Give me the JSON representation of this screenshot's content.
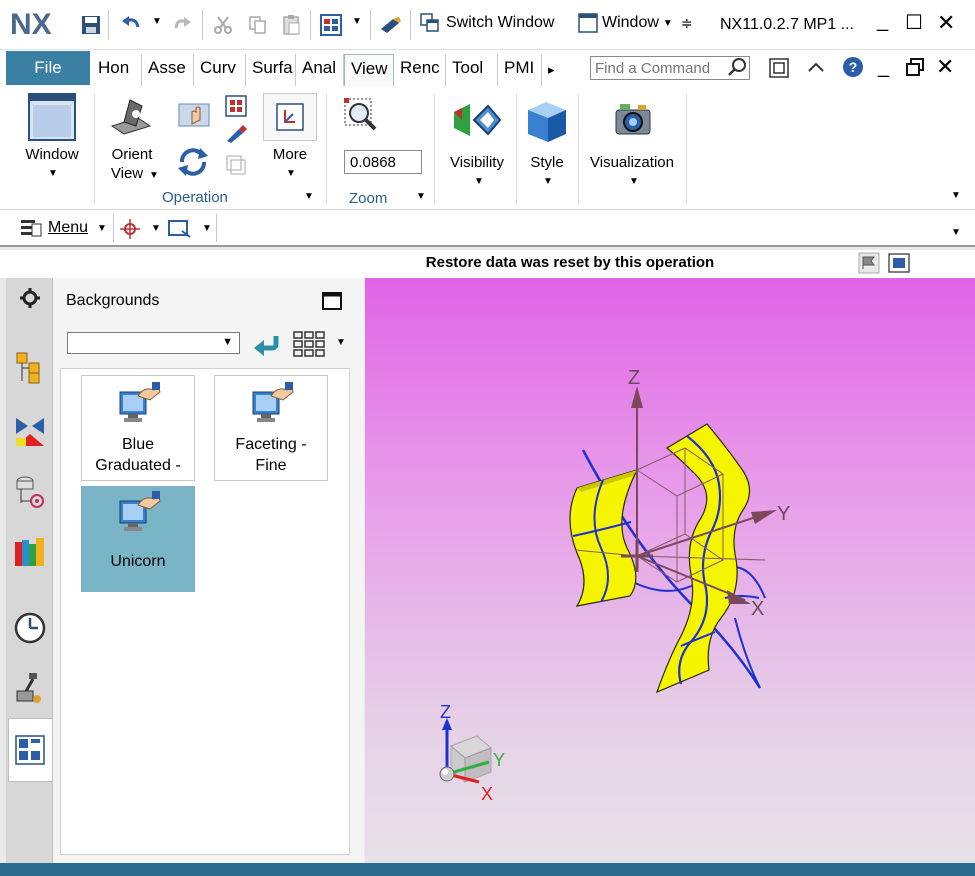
{
  "titlebar": {
    "logo": "NX",
    "switch_window": "Switch Window",
    "window_menu": "Window",
    "app_title": "NX11.0.2.7 MP1 ...",
    "minimize": "_",
    "maximize": "☐",
    "close": "✕"
  },
  "tabs": {
    "file": "File",
    "items": [
      "Hon",
      "Asse",
      "Curv",
      "Surfa",
      "Anal",
      "View",
      "Renc",
      "Tool",
      "PMI"
    ],
    "active": "View",
    "more": "▸",
    "find_placeholder": "Find a Command"
  },
  "ribbon": {
    "window_label": "Window",
    "orient_label1": "Orient",
    "orient_label2": "View",
    "more_label": "More",
    "operation_group": "Operation",
    "zoom_value": "0.0868",
    "zoom_group": "Zoom",
    "visibility_label": "Visibility",
    "style_label": "Style",
    "visualization_label": "Visualization"
  },
  "menubar": {
    "menu_label": "Menu"
  },
  "status": {
    "message": "Restore data was reset by this operation"
  },
  "panel": {
    "title": "Backgrounds",
    "dropdown_value": "",
    "tiles": [
      {
        "line1": "Blue",
        "line2": "Graduated -",
        "selected": false
      },
      {
        "line1": "Faceting -",
        "line2": "Fine",
        "selected": false
      },
      {
        "line1": "Unicorn",
        "line2": "",
        "selected": true
      }
    ]
  },
  "viewport": {
    "axis_z": "Z",
    "axis_y": "Y",
    "axis_x": "X",
    "triad_z": "Z",
    "triad_y": "Y",
    "triad_x": "X"
  },
  "colors": {
    "accent": "#3a7fa4",
    "selected_tile": "#79b5c6",
    "surface": "#f5f500",
    "curve": "#2030d0"
  }
}
